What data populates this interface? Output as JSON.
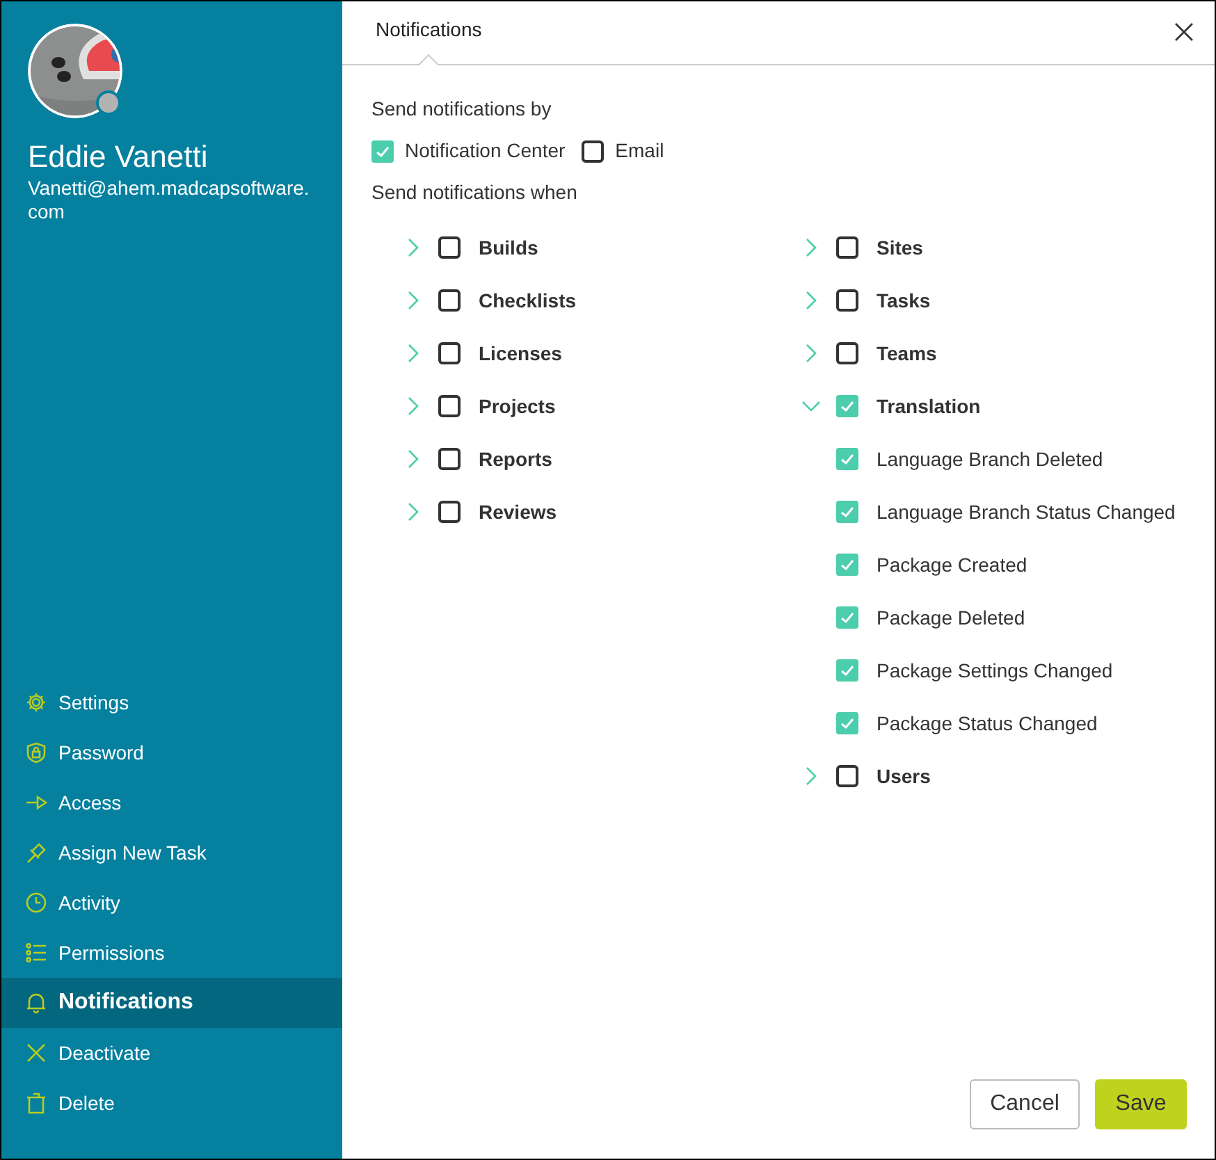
{
  "sidebar": {
    "user": {
      "name": "Eddie Vanetti",
      "email": "Vanetti@ahem.madcapsoftware.com"
    },
    "menu": [
      {
        "label": "Settings",
        "selected": false
      },
      {
        "label": "Password",
        "selected": false
      },
      {
        "label": "Access",
        "selected": false
      },
      {
        "label": "Assign New Task",
        "selected": false
      },
      {
        "label": "Activity",
        "selected": false
      },
      {
        "label": "Permissions",
        "selected": false
      },
      {
        "label": "Notifications",
        "selected": true
      },
      {
        "label": "Deactivate",
        "selected": false
      },
      {
        "label": "Delete",
        "selected": false
      }
    ]
  },
  "dialog": {
    "tabs": [
      {
        "label": "Notifications",
        "selected": true
      }
    ],
    "send_by_label": "Send notifications by",
    "channels": [
      {
        "label": "Notification Center",
        "checked": true
      },
      {
        "label": "Email",
        "checked": false
      }
    ],
    "send_when_label": "Send notifications when",
    "columns": [
      [
        {
          "label": "Builds",
          "checked": false,
          "expanded": false
        },
        {
          "label": "Checklists",
          "checked": false,
          "expanded": false
        },
        {
          "label": "Licenses",
          "checked": false,
          "expanded": false
        },
        {
          "label": "Projects",
          "checked": false,
          "expanded": false
        },
        {
          "label": "Reports",
          "checked": false,
          "expanded": false
        },
        {
          "label": "Reviews",
          "checked": false,
          "expanded": false
        }
      ],
      [
        {
          "label": "Sites",
          "checked": false,
          "expanded": false
        },
        {
          "label": "Tasks",
          "checked": false,
          "expanded": false
        },
        {
          "label": "Teams",
          "checked": false,
          "expanded": false
        },
        {
          "label": "Translation",
          "checked": true,
          "expanded": true,
          "children": [
            {
              "label": "Language Branch Deleted",
              "checked": true
            },
            {
              "label": "Language Branch Status Changed",
              "checked": true
            },
            {
              "label": "Package Created",
              "checked": true
            },
            {
              "label": "Package Deleted",
              "checked": true
            },
            {
              "label": "Package Settings Changed",
              "checked": true
            },
            {
              "label": "Package Status Changed",
              "checked": true
            }
          ]
        },
        {
          "label": "Users",
          "checked": false,
          "expanded": false
        }
      ]
    ],
    "buttons": [
      {
        "label": "Cancel",
        "kind": "secondary"
      },
      {
        "label": "Save",
        "kind": "primary"
      }
    ]
  }
}
